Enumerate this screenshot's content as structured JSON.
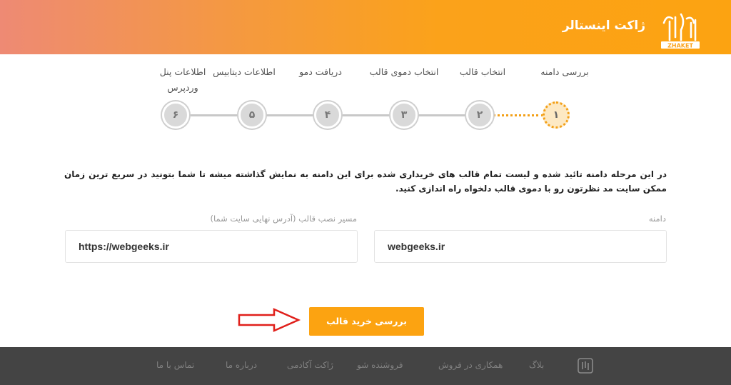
{
  "header": {
    "title": "ژاکت اینستالر",
    "logo_text": "ZHAKET"
  },
  "steps": [
    {
      "number": "۱",
      "label": "بررسی دامنه",
      "state": "active"
    },
    {
      "number": "۲",
      "label": "انتخاب قالب",
      "state": "pending"
    },
    {
      "number": "۳",
      "label": "انتخاب دموی قالب",
      "state": "pending"
    },
    {
      "number": "۴",
      "label": "دریافت دمو",
      "state": "pending"
    },
    {
      "number": "۵",
      "label": "اطلاعات دیتابیس",
      "state": "pending"
    },
    {
      "number": "۶",
      "label": "اطلاعات پنل وردپرس",
      "state": "pending"
    }
  ],
  "description": "در این مرحله دامنه تائید شده و لیست تمام قالب های خریداری شده برای این دامنه به نمایش گذاشته میشه تا شما بتونید در سریع ترین زمان ممکن سایت مد نظرتون رو با دموی قالب دلخواه راه اندازی کنید.",
  "form": {
    "domain_label": "دامنه",
    "domain_value": "webgeeks.ir",
    "path_label": "مسیر نصب قالب (آدرس نهایی سایت شما)",
    "path_value": "https://webgeeks.ir",
    "submit_label": "بررسی خرید قالب"
  },
  "footer": {
    "items": [
      "بلاگ",
      "همکاری در فروش",
      "فروشنده شو",
      "ژاکت آکادمی",
      "درباره ما",
      "تماس با ما"
    ]
  },
  "colors": {
    "accent": "#fca311",
    "header_gradient_start": "#ee8a74",
    "footer_bg": "#444444"
  }
}
